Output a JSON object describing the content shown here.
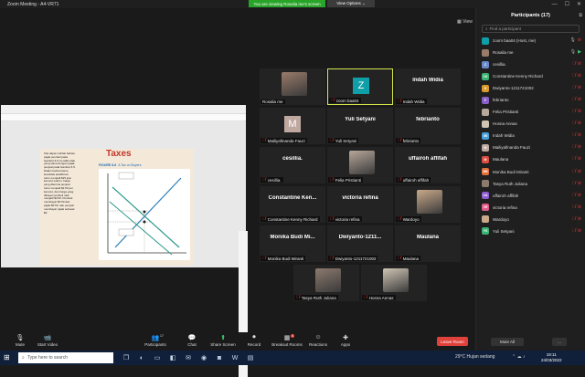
{
  "window": {
    "title": "Zoom Meeting - A4-VR71"
  },
  "share_banner": "You are viewing Rosalia me's screen",
  "view_options": "View Options ⌄",
  "view_button": "View",
  "shared_slide": {
    "title": "Taxes",
    "figure_label": "FIGURE 6-6",
    "figure_caption": "A Tax on Buyers",
    "body": "Kita dapat melihat bahwa\npajak pembeli pada\nGambar 6.6 memiliki efek\nyang sama dengan pajak\npenjual pada Gambar 6.5.\nDalam kedua kasus,\nkuantitas ekuilibrium\nturun menjadi $25 juta\nkerucut eskrim, harga\nyang diterima penjual\nturun menjadi $2.50 per\nkerucut, dan harga yang\ndibayar pembeli naik\nmenjadi $3.00. Pembeli\nmembayar $0.50 dari\npajak $0.50, dan penjual\nmembayar pajak sebesar\n$0."
  },
  "tiles": [
    {
      "name": "Rosalia me",
      "type": "photo",
      "photo_color": "#9a7b6a",
      "muted": false
    },
    {
      "name": "zoom baa04",
      "type": "avatar",
      "letter": "Z",
      "avatar_color": "#0e9fa8",
      "active": true,
      "muted": true
    },
    {
      "name": "Indah Widia",
      "type": "text",
      "big": "Indah Widia",
      "muted": true
    },
    {
      "name": "Mailiyafinanda Fauzi",
      "type": "avatar",
      "letter": "M",
      "avatar_color": "#bfa8a0",
      "muted": true
    },
    {
      "name": "Yuli Setyani",
      "type": "text",
      "big": "Yuli Setyani",
      "muted": true
    },
    {
      "name": "febrianto",
      "type": "text",
      "big": "febrianto",
      "muted": true
    },
    {
      "name": "cesillia.",
      "type": "text",
      "big": "cesillia.",
      "muted": true
    },
    {
      "name": "Felia Pristianti",
      "type": "photo",
      "photo_color": "#b7a79a",
      "muted": true
    },
    {
      "name": "uffairoh affifah",
      "type": "text",
      "big": "uffairoh affifah",
      "muted": true
    },
    {
      "name": "Constantine Kenny Richard",
      "type": "text",
      "big": "Constantine Ken...",
      "muted": true
    },
    {
      "name": "victoria refina",
      "type": "text",
      "big": "victoria refina",
      "muted": true
    },
    {
      "name": "Wardoyo",
      "type": "photo",
      "photo_color": "#c9a98a",
      "muted": true
    },
    {
      "name": "Monika Budi Miranti",
      "type": "text",
      "big": "Monika Budi Mi...",
      "muted": true
    },
    {
      "name": "Dwiyanto-1211721002",
      "type": "text",
      "big": "Dwiyanto-1211...",
      "muted": true
    },
    {
      "name": "Maulana",
      "type": "text",
      "big": "Maulana",
      "muted": true
    },
    {
      "name": "Tasya Ruth Juliana",
      "type": "photo",
      "photo_color": "#8c7a6e",
      "muted": true
    },
    {
      "name": "Hosna Annas",
      "type": "photo",
      "photo_color": "#d0c5b5",
      "muted": true
    }
  ],
  "bottom_bar": {
    "mute": "Mute",
    "start_video": "Start Video",
    "participants": "Participants",
    "participants_count": "17",
    "chat": "Chat",
    "share_screen": "Share Screen",
    "record": "Record",
    "breakout": "Breakout Rooms",
    "breakout_badge": "4",
    "reactions": "Reactions",
    "apps": "Apps",
    "leave": "Leave Room"
  },
  "panel": {
    "header": "Participants (17)",
    "search_placeholder": "Find a participant",
    "participants": [
      {
        "name": "zoom baa04 (Host, me)",
        "initials": "",
        "color": "#0e9fa8",
        "icon": "Z",
        "mic": "on",
        "video": "off"
      },
      {
        "name": "Rosalia me",
        "initials": "",
        "color": "#9a7b6a",
        "icon": "R",
        "mic": "on",
        "video": "on"
      },
      {
        "name": "cesillia.",
        "initials": "C",
        "color": "#6a89c8",
        "mic": "off",
        "video": "off"
      },
      {
        "name": "Constantine Kenny Richard",
        "initials": "CK",
        "color": "#3bb273",
        "mic": "off",
        "video": "off"
      },
      {
        "name": "Dwiyanto-1211721002",
        "initials": "D",
        "color": "#d99a2b",
        "mic": "off",
        "video": "off"
      },
      {
        "name": "febrianto",
        "initials": "F",
        "color": "#8860c8",
        "mic": "off",
        "video": "off"
      },
      {
        "name": "Felia Pristianti",
        "initials": "",
        "color": "#b7a79a",
        "icon": "F",
        "mic": "off",
        "video": "off"
      },
      {
        "name": "Hosna Annas",
        "initials": "",
        "color": "#d0c5b5",
        "icon": "H",
        "mic": "off",
        "video": "off"
      },
      {
        "name": "Indah Widia",
        "initials": "IW",
        "color": "#4a9fd8",
        "mic": "off",
        "video": "off"
      },
      {
        "name": "Mailiyafinanda Fauzi",
        "initials": "M",
        "color": "#bfa8a0",
        "mic": "off",
        "video": "off"
      },
      {
        "name": "Maulana",
        "initials": "M",
        "color": "#d94f44",
        "mic": "off",
        "video": "off"
      },
      {
        "name": "Monika Budi Miranti",
        "initials": "MB",
        "color": "#e0703a",
        "mic": "off",
        "video": "off"
      },
      {
        "name": "Tasya Ruth Juliana",
        "initials": "",
        "color": "#8c7a6e",
        "icon": "T",
        "mic": "off",
        "video": "off"
      },
      {
        "name": "uffairoh affifah",
        "initials": "UA",
        "color": "#8c5bd0",
        "mic": "off",
        "video": "off"
      },
      {
        "name": "victoria refina",
        "initials": "VR",
        "color": "#e05a8a",
        "mic": "off",
        "video": "off"
      },
      {
        "name": "Wardoyo",
        "initials": "",
        "color": "#c9a98a",
        "icon": "W",
        "mic": "off",
        "video": "off"
      },
      {
        "name": "Yuli Setyani",
        "initials": "YS",
        "color": "#3bb273",
        "mic": "off",
        "video": "off"
      }
    ],
    "mute_all": "Mute All",
    "more": "..."
  },
  "taskbar": {
    "search_placeholder": "Type here to search",
    "weather": "29°C  Hujan sedang",
    "time": "19:11",
    "date": "24/03/2022"
  }
}
